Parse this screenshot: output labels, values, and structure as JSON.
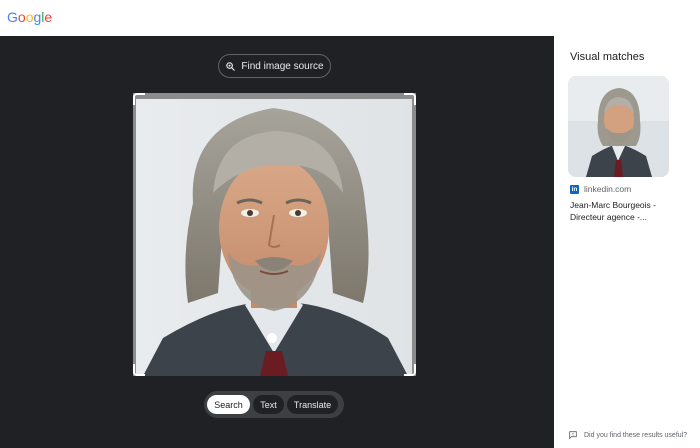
{
  "header": {
    "logo_letters": [
      {
        "ch": "G",
        "color": "#4285f4"
      },
      {
        "ch": "o",
        "color": "#ea4335"
      },
      {
        "ch": "o",
        "color": "#fbbc05"
      },
      {
        "ch": "g",
        "color": "#4285f4"
      },
      {
        "ch": "l",
        "color": "#34a853"
      },
      {
        "ch": "e",
        "color": "#ea4335"
      }
    ]
  },
  "viewer": {
    "find_source_label": "Find image source",
    "modes": [
      {
        "label": "Search",
        "active": true
      },
      {
        "label": "Text",
        "active": false
      },
      {
        "label": "Translate",
        "active": false
      }
    ]
  },
  "results": {
    "title": "Visual matches",
    "items": [
      {
        "source": "linkedin.com",
        "source_icon": "linkedin-icon",
        "title": "Jean-Marc Bourgeois - Directeur agence -..."
      }
    ]
  },
  "footer": {
    "feedback_text": "Did you find these results useful?"
  },
  "colors": {
    "dark_bg": "#202124",
    "linkedin": "#0a66c2"
  }
}
